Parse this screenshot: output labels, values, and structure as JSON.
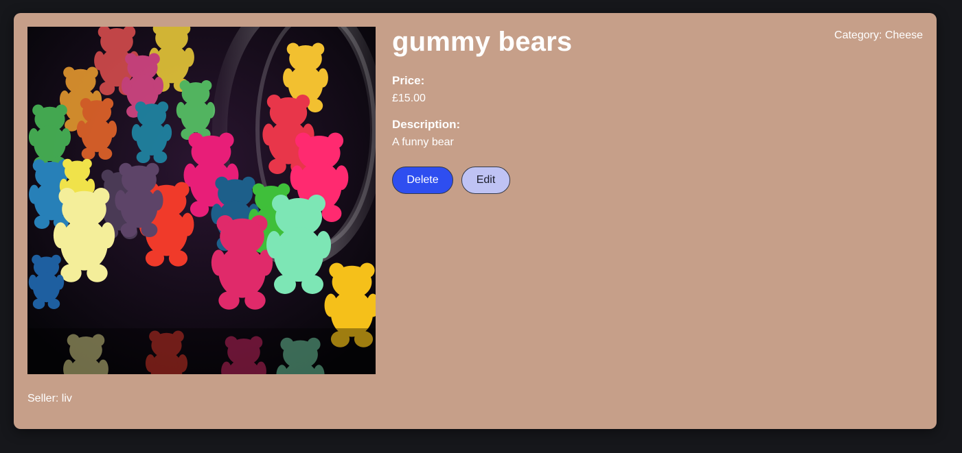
{
  "product": {
    "title": "gummy bears",
    "category_text": "Category: Cheese",
    "price_label": "Price:",
    "price_value": "£15.00",
    "description_label": "Description:",
    "description_value": "A funny bear",
    "seller_text": "Seller: liv",
    "image_subject": "colorful gummy bears spilling from a glass jar"
  },
  "actions": {
    "delete_label": "Delete",
    "edit_label": "Edit"
  },
  "colors": {
    "page_background": "#16171b",
    "card_background": "#c69f89",
    "delete_button": "#2e4ef0",
    "edit_button": "#bfc3f4",
    "text": "#ffffff"
  }
}
